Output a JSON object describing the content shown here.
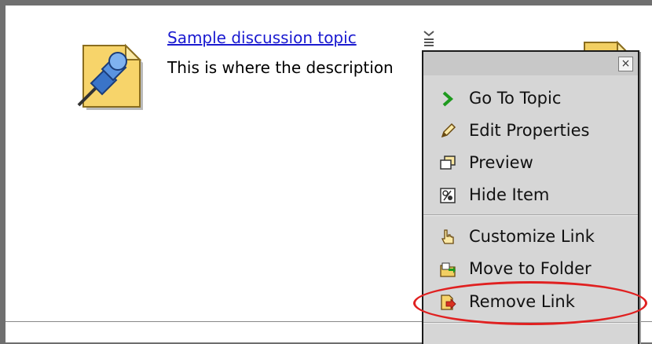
{
  "topic": {
    "link_text": "Sample discussion topic",
    "description": "This is where the description"
  },
  "menu": {
    "close_label": "×",
    "items": [
      {
        "label": "Go To Topic",
        "icon": "chevron-right-icon"
      },
      {
        "label": "Edit Properties",
        "icon": "pencil-icon"
      },
      {
        "label": "Preview",
        "icon": "preview-window-icon"
      },
      {
        "label": "Hide Item",
        "icon": "hide-item-icon"
      },
      {
        "label": "Customize Link",
        "icon": "hand-pointer-icon"
      },
      {
        "label": "Move to Folder",
        "icon": "move-folder-icon"
      },
      {
        "label": "Remove Link",
        "icon": "remove-link-icon"
      }
    ]
  },
  "colors": {
    "link": "#1a1ad0",
    "menu_bg": "#d6d6d6",
    "highlight": "#e02020",
    "go_arrow": "#1e9a1e"
  }
}
